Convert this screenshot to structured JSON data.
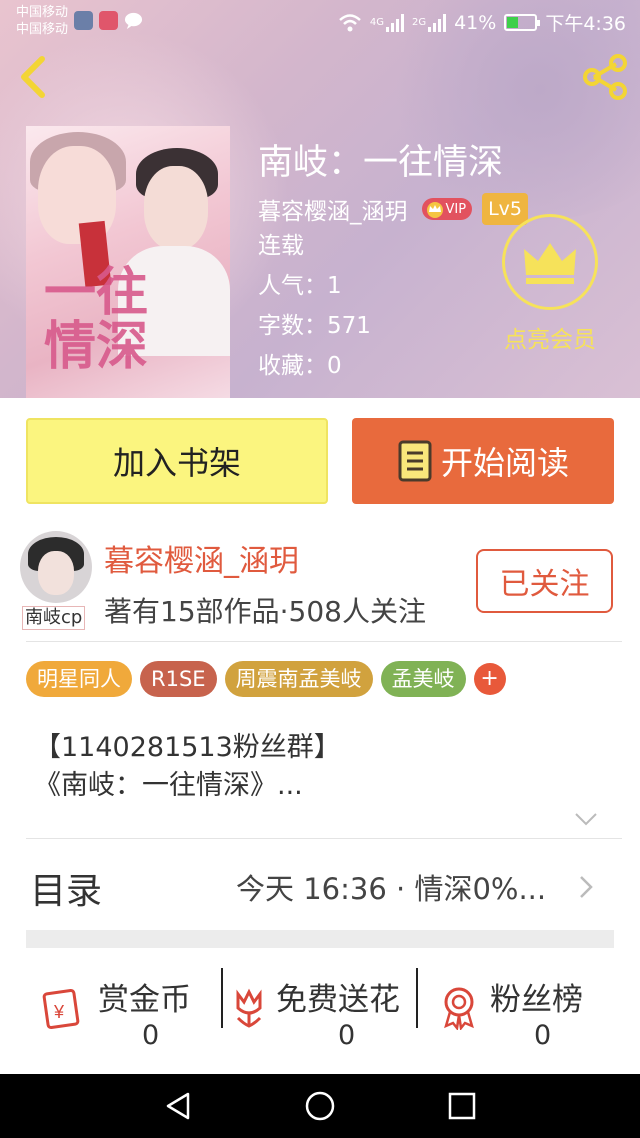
{
  "status_bar": {
    "carrier_1": "中国移动",
    "carrier_2": "中国移动",
    "network_1": "4G",
    "network_2": "2G",
    "battery": "41%",
    "battery_level": 0.41,
    "time": "下午4:36"
  },
  "book": {
    "title": "南岐：一往情深",
    "author": "暮容樱涵_涵玥",
    "vip_label": "VIP",
    "level": "Lv5",
    "status": "连载",
    "popularity": "人气：1",
    "word_count": "字数：571",
    "favorites": "收藏：0",
    "cover_art_title": [
      "一往",
      "情深"
    ]
  },
  "member": {
    "label": "点亮会员"
  },
  "actions": {
    "add_shelf": "加入书架",
    "start_read": "开始阅读"
  },
  "author_card": {
    "name": "暮容樱涵_涵玥",
    "stats": "著有15部作品·508人关注",
    "avatar_tag": "南岐cp",
    "follow": "已关注"
  },
  "tags": [
    {
      "label": "明星同人",
      "color": "#f0a93b"
    },
    {
      "label": "R1SE",
      "color": "#c7634d"
    },
    {
      "label": "周震南孟美岐",
      "color": "#d1a23e"
    },
    {
      "label": "孟美岐",
      "color": "#80b255"
    }
  ],
  "tag_more": "+",
  "description": {
    "line1": "【1140281513粉丝群】",
    "line2": "《南岐：一往情深》..."
  },
  "toc": {
    "label": "目录",
    "latest": "今天 16:36 · 情深0%..."
  },
  "stats": [
    {
      "label": "赏金币",
      "value": "0",
      "icon": "red-envelope-icon"
    },
    {
      "label": "免费送花",
      "value": "0",
      "icon": "flower-icon"
    },
    {
      "label": "粉丝榜",
      "value": "0",
      "icon": "medal-icon"
    }
  ],
  "colors": {
    "accent": "#e86a3d",
    "shelf_button": "#fbf57f",
    "member_yellow": "#f6e25a",
    "icon_red": "#d9473a"
  }
}
